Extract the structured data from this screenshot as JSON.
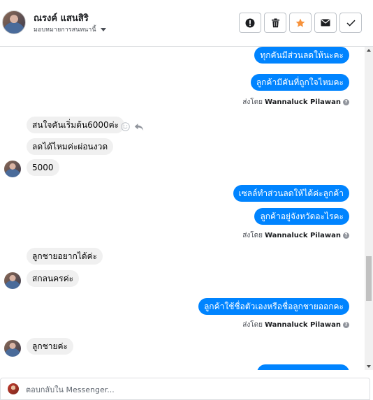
{
  "header": {
    "contact_name": "ณรงค์ แสนสิริ",
    "assign_label": "มอบหมายการสนทนานี้",
    "actions": [
      {
        "name": "mark-spam-button",
        "icon": "exclamation-icon"
      },
      {
        "name": "delete-button",
        "icon": "trash-icon"
      },
      {
        "name": "star-button",
        "icon": "star-icon",
        "color": "#f7923b"
      },
      {
        "name": "mark-unread-button",
        "icon": "envelope-icon"
      },
      {
        "name": "mark-done-button",
        "icon": "check-icon"
      }
    ]
  },
  "messages": {
    "m1": "ทุกคันมีส่วนลดให้นะคะ",
    "m2": "ลูกค้ามีคันที่ถูกใจไหมคะ",
    "m3": "สนใจคันเริ่มต้น6000ค่ะ",
    "m4": "ลดได้ไหมค่ะผ่อนงวด",
    "m5": "5000",
    "m6": "เซลล์ทำส่วนลดให้ได้ค่ะลูกค้า",
    "m7": "ลูกค้าอยู่จังหวัดอะไรคะ",
    "m8": "ลูกชายอยากได้ค่ะ",
    "m9": "สกลนครค่ะ",
    "m10": "ลูกค้าใช้ชื่อตัวเองหรือชื่อลูกชายออกคะ",
    "m11": "ลูกชายค่ะ"
  },
  "sent_by": {
    "prefix": "ส่งโดย",
    "agent": "Wannaluck Pilawan",
    "help": "?"
  },
  "composer": {
    "placeholder": "ตอบกลับใน Messenger..."
  },
  "colors": {
    "outgoing_bubble": "#0084ff",
    "incoming_bubble": "#f0f0f0"
  }
}
